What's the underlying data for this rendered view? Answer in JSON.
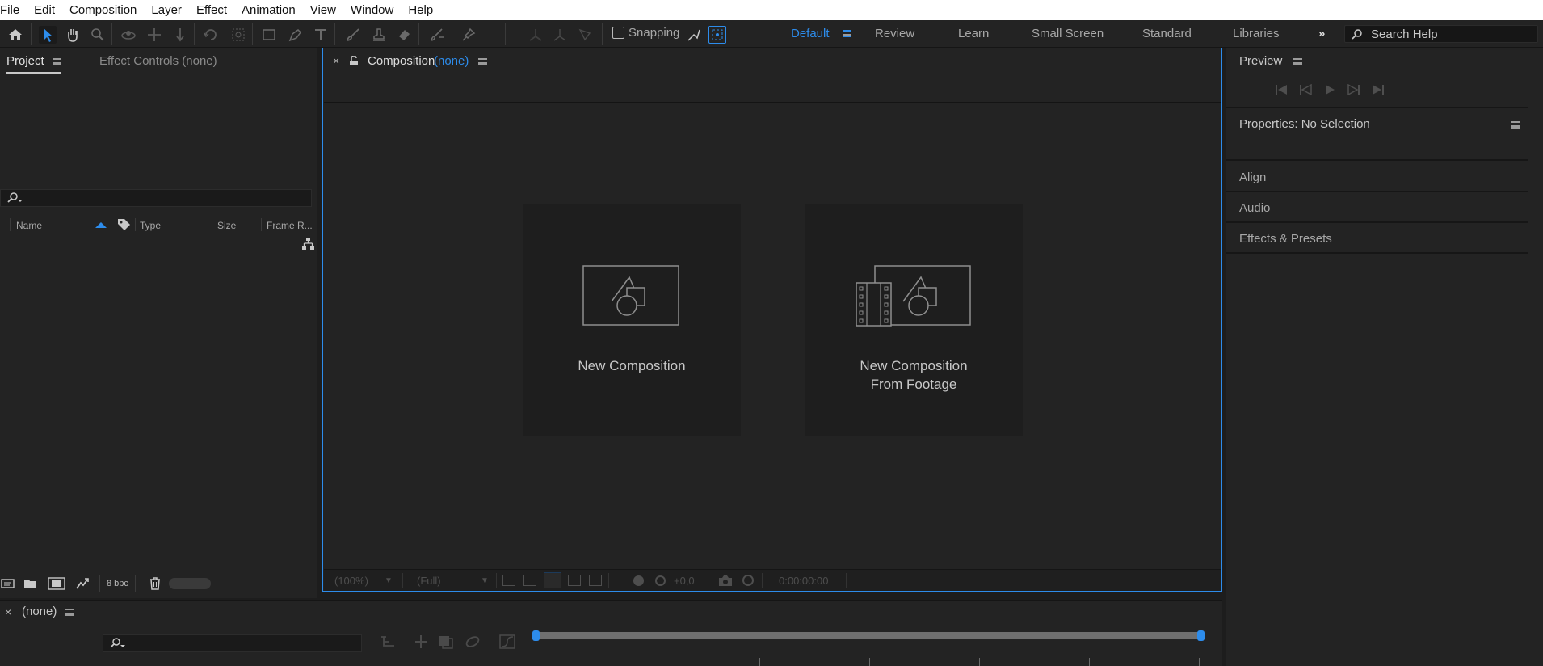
{
  "menu": [
    "File",
    "Edit",
    "Composition",
    "Layer",
    "Effect",
    "Animation",
    "View",
    "Window",
    "Help"
  ],
  "toolbar": {
    "snapping_label": "Snapping",
    "workspaces": [
      "Default",
      "Review",
      "Learn",
      "Small Screen",
      "Standard",
      "Libraries"
    ],
    "active_workspace": "Default",
    "search_placeholder": "Search Help"
  },
  "project_panel": {
    "tab_project": "Project",
    "tab_effect_controls": "Effect Controls (none)",
    "columns": [
      "Name",
      "Type",
      "Size",
      "Frame R..."
    ],
    "bpc_label": "8 bpc"
  },
  "composition_panel": {
    "tab_label": "Composition",
    "tab_value": "(none)",
    "cards": {
      "new_composition": "New Composition",
      "from_footage_line1": "New Composition",
      "from_footage_line2": "From Footage"
    },
    "footer": {
      "zoom": "(100%)",
      "resolution": "(Full)",
      "exposure": "+0,0",
      "timecode": "0:00:00:00"
    }
  },
  "right_panels": {
    "preview": "Preview",
    "properties": "Properties: No Selection",
    "align": "Align",
    "audio": "Audio",
    "effects_presets": "Effects & Presets"
  },
  "timeline": {
    "tab_label": "(none)"
  },
  "colors": {
    "accent": "#2d8ceb",
    "panel_bg": "#232323",
    "card_bg": "#1e1e1e"
  }
}
